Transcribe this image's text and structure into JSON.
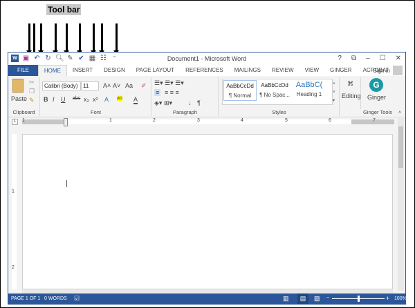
{
  "annotation": {
    "label": "Tool bar"
  },
  "window": {
    "title": "Document1 - Microsoft Word",
    "controls": [
      "?",
      "⧉",
      "–",
      "☐",
      "✕"
    ],
    "sign_in": "Sign in"
  },
  "qat": {
    "icons": [
      "word-logo-icon",
      "save-icon",
      "undo-icon",
      "redo-icon",
      "print-preview-icon",
      "edit-icon",
      "spelling-icon",
      "table-icon",
      "columns-icon"
    ]
  },
  "tabs": [
    "FILE",
    "HOME",
    "INSERT",
    "DESIGN",
    "PAGE LAYOUT",
    "REFERENCES",
    "MAILINGS",
    "REVIEW",
    "VIEW",
    "GINGER",
    "ACROBAT"
  ],
  "active_tab": "HOME",
  "ribbon": {
    "clipboard": {
      "paste": "Paste",
      "label": "Clipboard"
    },
    "font": {
      "name": "Calibri (Body)",
      "size": "11",
      "label": "Font",
      "case": "Aa"
    },
    "paragraph": {
      "label": "Paragraph"
    },
    "styles": {
      "items": [
        {
          "preview": "AaBbCcDd",
          "name": "¶ Normal"
        },
        {
          "preview": "AaBbCcDd",
          "name": "¶ No Spac..."
        },
        {
          "preview": "AaBbC(",
          "name": "Heading 1"
        }
      ],
      "label": "Styles"
    },
    "editing": {
      "label": "Editing"
    },
    "ginger": {
      "button": "Ginger",
      "label": "Ginger Tools",
      "logo": "G"
    }
  },
  "ruler": {
    "numbers": [
      "1",
      "1",
      "2",
      "3",
      "4",
      "5",
      "6",
      "7"
    ]
  },
  "vruler": {
    "numbers": [
      "1",
      "2"
    ]
  },
  "status": {
    "page": "PAGE 1 OF 1",
    "words": "0 WORDS",
    "zoom": "100%",
    "zoom_level": 100
  },
  "colors": {
    "accent": "#2b579a",
    "ginger": "#1a9aa6",
    "font_color": "#d00000"
  }
}
